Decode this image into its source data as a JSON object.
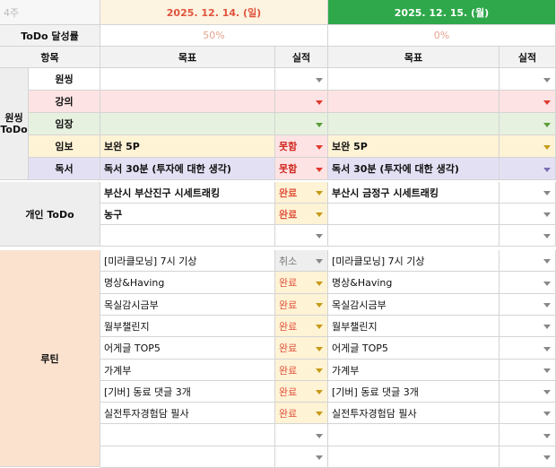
{
  "colors": {
    "header_left_bg": "#fdf3e1",
    "header_left_text": "#e0533c",
    "header_right_bg": "#2ea84a",
    "header_right_text": "#ffffff",
    "label_bg": "#f2f2f2",
    "section_ws_bg": "#eeeeee",
    "section_personal_bg": "#eeeeee",
    "section_routine_bg": "#fbe2cf",
    "row_lecture_bg": "#fde3e4",
    "row_imjang_bg": "#e6f1df",
    "row_imbo_bg": "#fff3d6",
    "row_reading_bg": "#e4e0f4",
    "fail_bg": "#fde3e4",
    "fail_text": "#d0281f",
    "done_bg": "#fff3d6",
    "done_text": "#e0533c",
    "cancel_bg": "#eeeeee",
    "cancel_text": "#777777"
  },
  "header": {
    "left_label": "4주",
    "date1": "2025. 12. 14. (일)",
    "date2": "2025. 12. 15. (월)"
  },
  "achievement": {
    "label": "ToDo 달성률",
    "day1": "50%",
    "day2": "0%"
  },
  "columns": {
    "item": "항목",
    "goal": "목표",
    "result": "실적"
  },
  "sections": {
    "ws_todo": "원씽\nToDo",
    "personal_todo": "개인 ToDo",
    "routine": "루틴"
  },
  "ws_rows": [
    {
      "name": "원씽",
      "goal1": "",
      "result1": "",
      "goal2": "",
      "result2": ""
    },
    {
      "name": "강의",
      "goal1": "",
      "result1": "",
      "goal2": "",
      "result2": ""
    },
    {
      "name": "임장",
      "goal1": "",
      "result1": "",
      "goal2": "",
      "result2": ""
    },
    {
      "name": "임보",
      "goal1": "보완 5P",
      "result1": "못함",
      "goal2": "보완 5P",
      "result2": ""
    },
    {
      "name": "독서",
      "goal1": "독서 30분 (투자에 대한 생각)",
      "result1": "못함",
      "goal2": "독서 30분 (투자에 대한 생각)",
      "result2": ""
    }
  ],
  "personal_rows": [
    {
      "goal1": "부산시 부산진구 시세트래킹",
      "result1": "완료",
      "goal2": "부산시 금정구 시세트래킹",
      "result2": ""
    },
    {
      "goal1": "농구",
      "result1": "완료",
      "goal2": "",
      "result2": ""
    },
    {
      "goal1": "",
      "result1": "",
      "goal2": "",
      "result2": ""
    }
  ],
  "routine_rows": [
    {
      "goal1": "[미라클모닝] 7시 기상",
      "result1": "취소",
      "goal2": "[미라클모닝] 7시 기상",
      "result2": ""
    },
    {
      "goal1": "명상&Having",
      "result1": "완료",
      "goal2": "명상&Having",
      "result2": ""
    },
    {
      "goal1": "목실감시금부",
      "result1": "완료",
      "goal2": "목실감시금부",
      "result2": ""
    },
    {
      "goal1": "월부챌린지",
      "result1": "완료",
      "goal2": "월부챌린지",
      "result2": ""
    },
    {
      "goal1": "어게글 TOP5",
      "result1": "완료",
      "goal2": "어게글 TOP5",
      "result2": ""
    },
    {
      "goal1": "가계부",
      "result1": "완료",
      "goal2": "가계부",
      "result2": ""
    },
    {
      "goal1": "[기버] 동료 댓글 3개",
      "result1": "완료",
      "goal2": "[기버] 동료 댓글 3개",
      "result2": ""
    },
    {
      "goal1": "실전투자경험담 필사",
      "result1": "완료",
      "goal2": "실전투자경험담 필사",
      "result2": ""
    },
    {
      "goal1": "",
      "result1": "",
      "goal2": "",
      "result2": ""
    },
    {
      "goal1": "",
      "result1": "",
      "goal2": "",
      "result2": ""
    }
  ]
}
